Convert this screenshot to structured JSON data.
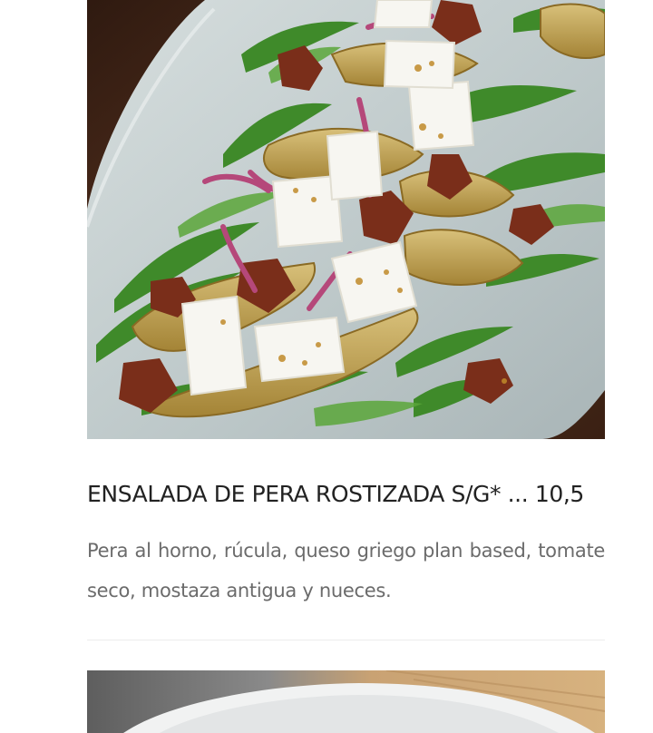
{
  "menu": {
    "items": [
      {
        "title": "ENSALADA DE PERA ROSTIZADA S/G* ... 10,5",
        "description": "Pera al horno, rúcula, queso griego plan based, tomate seco, mostaza antigua y nueces.",
        "image": "pear-salad-photo"
      }
    ],
    "next_item": {
      "image": "next-dish-photo"
    }
  },
  "colors": {
    "title": "#222222",
    "description": "#6b6b6b",
    "divider": "#ececec",
    "plate": "#c9d2d2",
    "table_wood": "#4a2a18"
  }
}
